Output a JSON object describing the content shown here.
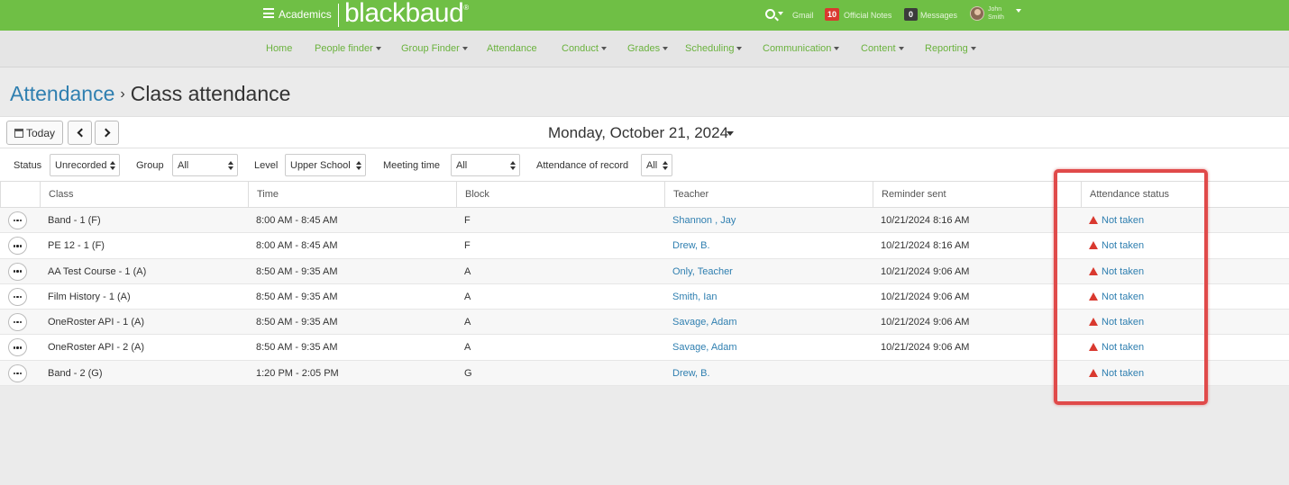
{
  "topbar": {
    "app_name": "Academics",
    "brand": "blackbaud",
    "gmail_label": "Gmail",
    "notes_count": "10",
    "notes_label": "Official Notes",
    "messages_count": "0",
    "messages_label": "Messages",
    "user_first": "John",
    "user_last": "Smith",
    "colors": {
      "bar": "#6fbf45"
    }
  },
  "nav": {
    "items": [
      {
        "label": "Home",
        "dropdown": false
      },
      {
        "label": "People finder",
        "dropdown": true
      },
      {
        "label": "Group Finder",
        "dropdown": true
      },
      {
        "label": "Attendance",
        "dropdown": false
      },
      {
        "label": "Conduct",
        "dropdown": true
      },
      {
        "label": "Grades",
        "dropdown": true
      },
      {
        "label": "Scheduling",
        "dropdown": true
      },
      {
        "label": "Communication",
        "dropdown": true
      },
      {
        "label": "Content",
        "dropdown": true
      },
      {
        "label": "Reporting",
        "dropdown": true
      }
    ]
  },
  "breadcrumb": {
    "parent": "Attendance",
    "separator": "›",
    "current": "Class attendance"
  },
  "toolbar": {
    "today_label": "Today",
    "date": "Monday, October 21, 2024"
  },
  "filters": {
    "status_label": "Status",
    "status_value": "Unrecorded",
    "group_label": "Group",
    "group_value": "All",
    "level_label": "Level",
    "level_value": "Upper School",
    "meeting_label": "Meeting time",
    "meeting_value": "All",
    "record_label": "Attendance of record",
    "record_value": "All"
  },
  "table": {
    "headers": [
      "Class",
      "Time",
      "Block",
      "Teacher",
      "Reminder sent",
      "Attendance status"
    ],
    "rows": [
      {
        "class": "Band - 1 (F)",
        "time": "8:00 AM - 8:45 AM",
        "block": "F",
        "teacher": "Shannon , Jay",
        "reminder": "10/21/2024 8:16 AM",
        "status": "Not taken"
      },
      {
        "class": "PE 12 - 1 (F)",
        "time": "8:00 AM - 8:45 AM",
        "block": "F",
        "teacher": "Drew, B.",
        "reminder": "10/21/2024 8:16 AM",
        "status": "Not taken"
      },
      {
        "class": "AA Test Course - 1 (A)",
        "time": "8:50 AM - 9:35 AM",
        "block": "A",
        "teacher": "Only, Teacher",
        "reminder": "10/21/2024 9:06 AM",
        "status": "Not taken"
      },
      {
        "class": "Film History - 1 (A)",
        "time": "8:50 AM - 9:35 AM",
        "block": "A",
        "teacher": "Smith, Ian",
        "reminder": "10/21/2024 9:06 AM",
        "status": "Not taken"
      },
      {
        "class": "OneRoster API - 1 (A)",
        "time": "8:50 AM - 9:35 AM",
        "block": "A",
        "teacher": "Savage, Adam",
        "reminder": "10/21/2024 9:06 AM",
        "status": "Not taken"
      },
      {
        "class": "OneRoster API - 2 (A)",
        "time": "8:50 AM - 9:35 AM",
        "block": "A",
        "teacher": "Savage, Adam",
        "reminder": "10/21/2024 9:06 AM",
        "status": "Not taken"
      },
      {
        "class": "Band - 2 (G)",
        "time": "1:20 PM - 2:05 PM",
        "block": "G",
        "teacher": "Drew, B.",
        "reminder": "",
        "status": "Not taken"
      }
    ]
  }
}
